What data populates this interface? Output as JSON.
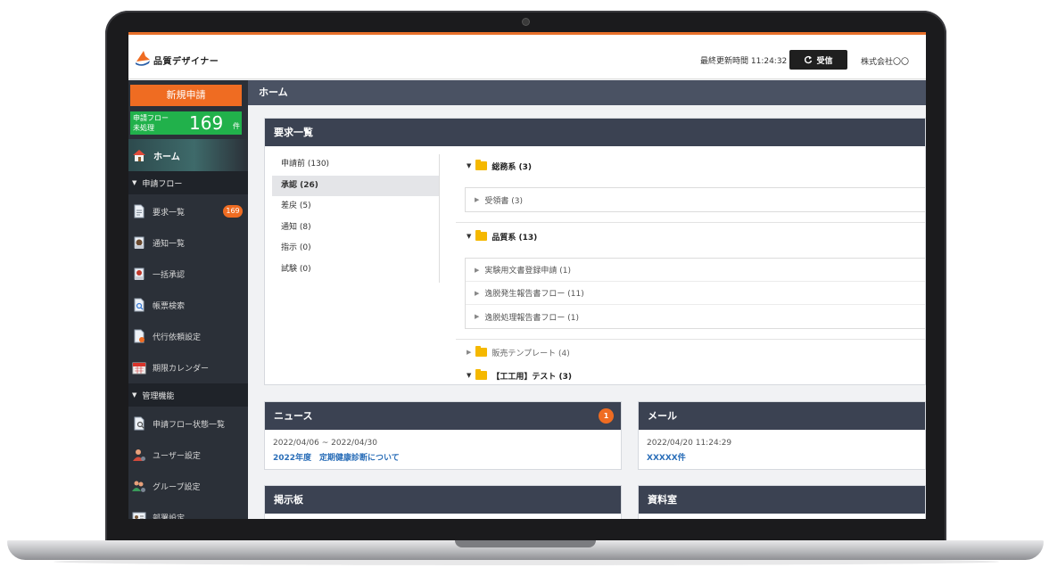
{
  "header": {
    "app_name": "品質デザイナー",
    "last_updated": "最終更新時間 11:24:32",
    "receive_button": "受信",
    "company": "株式会社〇〇"
  },
  "sidebar": {
    "new_request": "新規申請",
    "counter": {
      "label_line1": "申請フロー",
      "label_line2": "未処理",
      "value": "169",
      "unit": "件"
    },
    "home": "ホーム",
    "section_flow": "申請フロー",
    "flow_items": [
      {
        "label": "要求一覧",
        "badge": "169",
        "icon": "document-icon"
      },
      {
        "label": "通知一覧",
        "icon": "notice-icon"
      },
      {
        "label": "一括承認",
        "icon": "approve-icon"
      },
      {
        "label": "帳票検索",
        "icon": "search-doc-icon"
      },
      {
        "label": "代行依頼設定",
        "icon": "proxy-doc-icon"
      },
      {
        "label": "期限カレンダー",
        "icon": "calendar-icon"
      }
    ],
    "section_admin": "管理機能",
    "admin_items": [
      {
        "label": "申請フロー状態一覧",
        "icon": "flow-status-icon"
      },
      {
        "label": "ユーザー設定",
        "icon": "user-settings-icon"
      },
      {
        "label": "グループ設定",
        "icon": "group-settings-icon"
      },
      {
        "label": "部署設定",
        "icon": "department-icon"
      }
    ]
  },
  "main": {
    "page_title": "ホーム",
    "request_panel": {
      "title": "要求一覧",
      "statuses": [
        {
          "label": "申請前 (130)",
          "active": false
        },
        {
          "label": "承認 (26)",
          "active": true
        },
        {
          "label": "差戻 (5)",
          "active": false
        },
        {
          "label": "通知 (8)",
          "active": false
        },
        {
          "label": "指示 (0)",
          "active": false
        },
        {
          "label": "試験 (0)",
          "active": false
        }
      ],
      "tree": {
        "folder1": "総務系 (3)",
        "folder1_items": [
          "受領書 (3)"
        ],
        "folder2": "品質系 (13)",
        "folder2_items": [
          "実験用文書登録申請 (1)",
          "逸脱発生報告書フロー (11)",
          "逸脱処理報告書フロー (1)"
        ],
        "folder3": "販売テンプレート (4)",
        "folder4": "【工工用】テスト (3)"
      }
    },
    "news": {
      "title": "ニュース",
      "badge": "1",
      "date": "2022/04/06 ~ 2022/04/30",
      "link": "2022年度　定期健康診断について"
    },
    "mail": {
      "title": "メール",
      "date": "2022/04/20 11:24:29",
      "link": "XXXXX件"
    },
    "board": {
      "title": "掲示板"
    },
    "files": {
      "title": "資料室"
    }
  },
  "colors": {
    "accent_orange": "#ef6c22",
    "counter_green": "#21b14b",
    "sidebar_bg": "#2b3038",
    "panel_header": "#3b4252",
    "link_blue": "#2a6eb8"
  }
}
